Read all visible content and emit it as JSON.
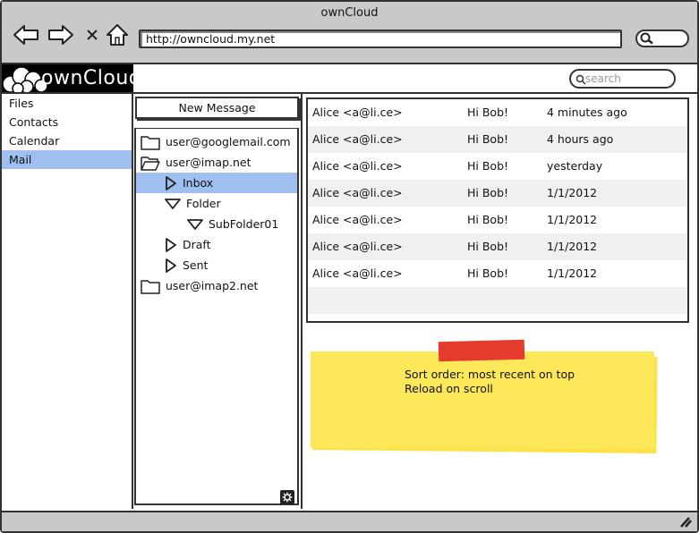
{
  "window": {
    "title": "ownCloud"
  },
  "browser": {
    "url": "http://owncloud.my.net",
    "icons": [
      "back-arrow-icon",
      "forward-arrow-icon",
      "close-x-icon",
      "home-icon",
      "search-icon"
    ]
  },
  "app": {
    "logo_text": "ownCloud",
    "search_placeholder": "search"
  },
  "sidebar": {
    "items": [
      {
        "label": "Files"
      },
      {
        "label": "Contacts"
      },
      {
        "label": "Calendar"
      },
      {
        "label": "Mail",
        "active": true
      }
    ]
  },
  "folders": {
    "new_message_label": "New Message",
    "tree": [
      {
        "label": "user@googlemail.com",
        "icon": "folder-closed-icon",
        "level": 0
      },
      {
        "label": "user@imap.net",
        "icon": "folder-open-icon",
        "level": 0
      },
      {
        "label": "Inbox",
        "icon": "triangle-right-icon",
        "level": 1,
        "active": true
      },
      {
        "label": "Folder",
        "icon": "triangle-down-icon",
        "level": 1
      },
      {
        "label": "SubFolder01",
        "icon": "triangle-down-icon",
        "level": 2
      },
      {
        "label": "Draft",
        "icon": "triangle-right-icon",
        "level": 1
      },
      {
        "label": "Sent",
        "icon": "triangle-right-icon",
        "level": 1
      },
      {
        "label": "user@imap2.net",
        "icon": "folder-closed-icon",
        "level": 0
      }
    ]
  },
  "messages": {
    "rows": [
      {
        "from": "Alice <a@li.ce>",
        "subject": "Hi Bob!",
        "date": "4 minutes ago"
      },
      {
        "from": "Alice <a@li.ce>",
        "subject": "Hi Bob!",
        "date": "4 hours ago"
      },
      {
        "from": "Alice <a@li.ce>",
        "subject": "Hi Bob!",
        "date": "yesterday"
      },
      {
        "from": "Alice <a@li.ce>",
        "subject": "Hi Bob!",
        "date": "1/1/2012"
      },
      {
        "from": "Alice <a@li.ce>",
        "subject": "Hi Bob!",
        "date": "1/1/2012"
      },
      {
        "from": "Alice <a@li.ce>",
        "subject": "Hi Bob!",
        "date": "1/1/2012"
      },
      {
        "from": "Alice <a@li.ce>",
        "subject": "Hi Bob!",
        "date": "1/1/2012"
      }
    ]
  },
  "note": {
    "line1": "Sort order: most recent on top",
    "line2": "Reload on scroll"
  },
  "colors": {
    "chrome": "#c9c9c9",
    "selection": "#9ebff0",
    "sticky": "#fde85a",
    "tape": "#e53b2e"
  }
}
